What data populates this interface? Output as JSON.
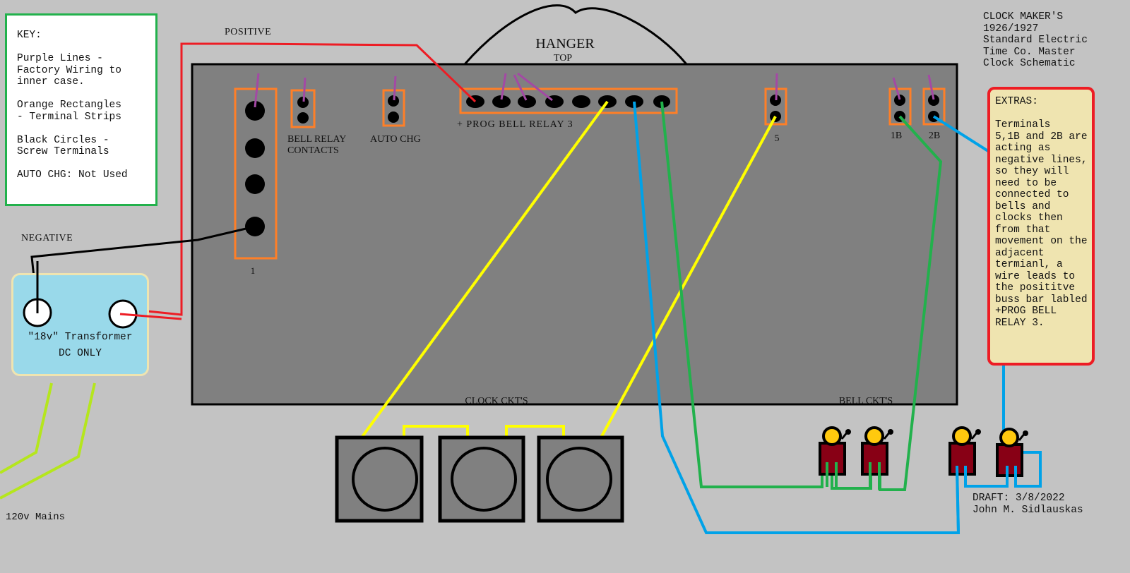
{
  "title_block": {
    "lines": "CLOCK MAKER'S\n1926/1927\nStandard Electric\nTime Co. Master\nClock Schematic"
  },
  "key": {
    "heading": "KEY:",
    "text": "KEY:\n\nPurple Lines -\nFactory Wiring to\ninner case.\n\nOrange Rectangles\n- Terminal Strips\n\nBlack Circles -\nScrew Terminals\n\nAUTO CHG: Not Used"
  },
  "extras": {
    "text": "EXTRAS:\n\nTerminals\n5,1B and 2B are\nacting as\nnegative lines,\nso they will\nneed to be\nconnected to\nbells and\nclocks then\nfrom that\nmovement on the\nadjacent\ntermianl, a\nwire leads to\nthe posititve\nbuss bar labled\n+PROG BELL\nRELAY 3."
  },
  "labels": {
    "positive": "POSITIVE",
    "negative": "NEGATIVE",
    "hanger": "HANGER",
    "top": "TOP",
    "terminal_1": "1",
    "bell_relay_contacts": "BELL RELAY\nCONTACTS",
    "auto_chg": "AUTO CHG",
    "prog_bell_relay": "+ PROG BELL RELAY 3",
    "terminal_5": "5",
    "terminal_1b": "1B",
    "terminal_2b": "2B",
    "clock_ckts": "CLOCK CKT'S",
    "bell_ckts": "BELL CKT'S",
    "mains": "120v Mains"
  },
  "transformer": {
    "title": "\"18v\" Transformer",
    "subtitle": "DC ONLY"
  },
  "draft": {
    "text": "DRAFT: 3/8/2022\nJohn M. Sidlauskas"
  },
  "colors": {
    "background": "#c3c3c3",
    "case": "#808080",
    "terminal_strip": "#ff7f27",
    "factory_wiring": "#a349a4",
    "positive_wire": "#ed1c24",
    "negative_wire": "#000000",
    "clock_wire": "#ffff00",
    "bell_wire_green": "#22b14c",
    "bell_wire_blue": "#00a2e8",
    "mains_wire": "#b5e61d",
    "bell_body": "#880015",
    "bell_dome": "#ffc90e"
  }
}
